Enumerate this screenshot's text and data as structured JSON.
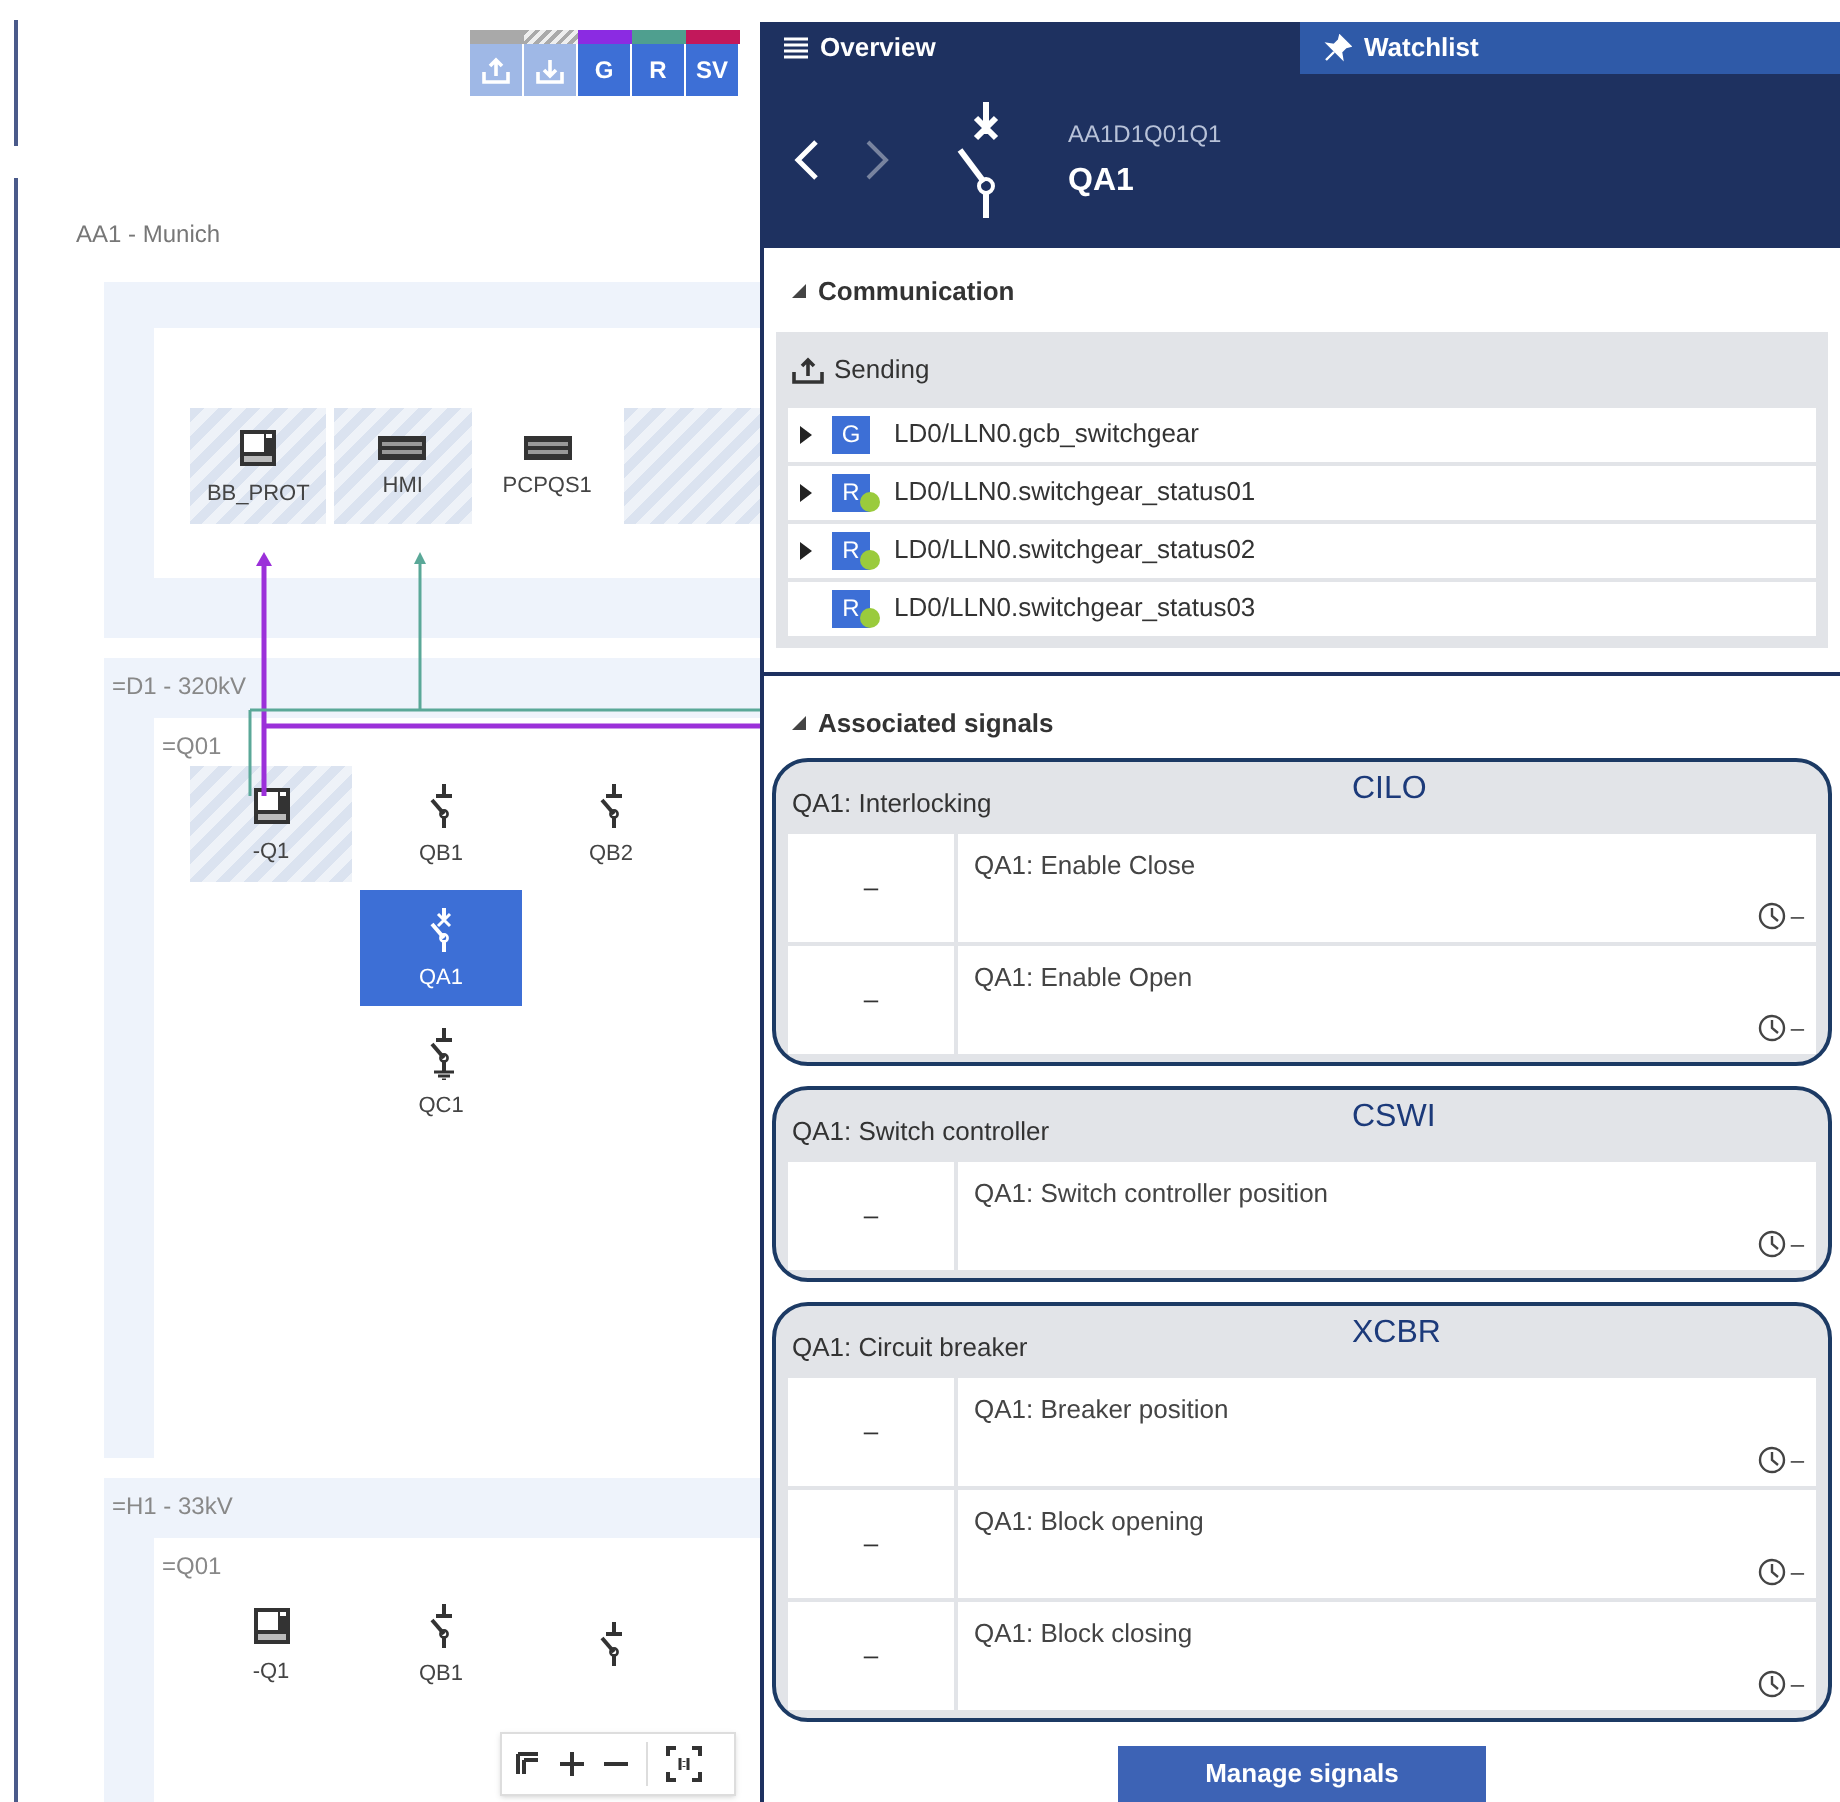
{
  "toolbar": [
    {
      "kind": "upload",
      "color": "#a9a9a9",
      "hatched": false
    },
    {
      "kind": "download",
      "color": "#a9a9a9",
      "hatched": true
    },
    {
      "kind": "text",
      "label": "G",
      "color": "#8b2be2",
      "hatched": false
    },
    {
      "kind": "text",
      "label": "R",
      "color": "#4f9f8f",
      "hatched": false
    },
    {
      "kind": "text",
      "label": "SV",
      "color": "#c2185b",
      "hatched": false
    }
  ],
  "substation": {
    "title": "AA1 - Munich",
    "ieds": [
      {
        "kind": "ied",
        "label": "BB_PROT",
        "hatched": true,
        "selected": false
      },
      {
        "kind": "hmi",
        "label": "HMI",
        "hatched": true,
        "selected": false
      },
      {
        "kind": "hmi",
        "label": "PCPQS1",
        "hatched": false,
        "selected": false
      },
      {
        "kind": "blank",
        "hatched": true,
        "selected": false
      }
    ],
    "voltage_levels": [
      {
        "title": "=D1 - 320kV",
        "bay": {
          "title": "=Q01",
          "columns": [
            [
              {
                "kind": "ied",
                "label": "-Q1",
                "hatched": true,
                "selected": false
              }
            ],
            [
              {
                "kind": "disconnector",
                "label": "QB1",
                "hatched": false,
                "selected": false
              },
              {
                "kind": "breaker",
                "label": "QA1",
                "hatched": false,
                "selected": true
              },
              {
                "kind": "earth",
                "label": "QC1",
                "hatched": false,
                "selected": false
              }
            ],
            [
              {
                "kind": "disconnector",
                "label": "QB2",
                "hatched": false,
                "selected": false
              }
            ]
          ]
        }
      },
      {
        "title": "=H1 - 33kV",
        "bay": {
          "title": "=Q01",
          "columns": [
            [
              {
                "kind": "ied",
                "label": "-Q1",
                "hatched": false,
                "selected": false
              }
            ],
            [
              {
                "kind": "disconnector",
                "label": "QB1",
                "hatched": false,
                "selected": false
              }
            ],
            [
              {
                "kind": "disconnector",
                "hatched": false,
                "selected": false
              }
            ]
          ]
        }
      }
    ]
  },
  "tabs": [
    {
      "label": "Overview",
      "kind": "list",
      "selected": true
    },
    {
      "label": "Watchlist",
      "kind": "pin",
      "selected": false
    }
  ],
  "header": {
    "back_enabled": true,
    "forward_enabled": false,
    "path": "AA1D1Q01Q1",
    "name": "QA1"
  },
  "communication": {
    "title": "Communication",
    "expanded": true,
    "group": {
      "title": "Sending",
      "items": [
        {
          "badge": "G",
          "kind": "goose",
          "label": "LD0/LLN0.gcb_switchgear",
          "expandable": true
        },
        {
          "badge": "R",
          "kind": "report",
          "label": "LD0/LLN0.switchgear_status01",
          "expandable": true
        },
        {
          "badge": "R",
          "kind": "report",
          "label": "LD0/LLN0.switchgear_status02",
          "expandable": true
        },
        {
          "badge": "R",
          "kind": "report",
          "label": "LD0/LLN0.switchgear_status03",
          "expandable": false
        }
      ]
    }
  },
  "associated": {
    "title": "Associated signals",
    "expanded": true,
    "groups": [
      {
        "title": "QA1: Interlocking",
        "annotation": "CILO",
        "signals": [
          {
            "value": "–",
            "name": "QA1: Enable Close",
            "time": "–"
          },
          {
            "value": "–",
            "name": "QA1: Enable Open",
            "time": "–"
          }
        ]
      },
      {
        "title": "QA1: Switch controller",
        "annotation": "CSWI",
        "signals": [
          {
            "value": "–",
            "name": "QA1: Switch controller position",
            "time": "–"
          }
        ]
      },
      {
        "title": "QA1: Circuit breaker",
        "annotation": "XCBR",
        "signals": [
          {
            "value": "–",
            "name": "QA1: Breaker position",
            "time": "–"
          },
          {
            "value": "–",
            "name": "QA1: Block opening",
            "time": "–"
          },
          {
            "value": "–",
            "name": "QA1: Block closing",
            "time": "–"
          }
        ]
      }
    ]
  },
  "manage_button": "Manage signals"
}
